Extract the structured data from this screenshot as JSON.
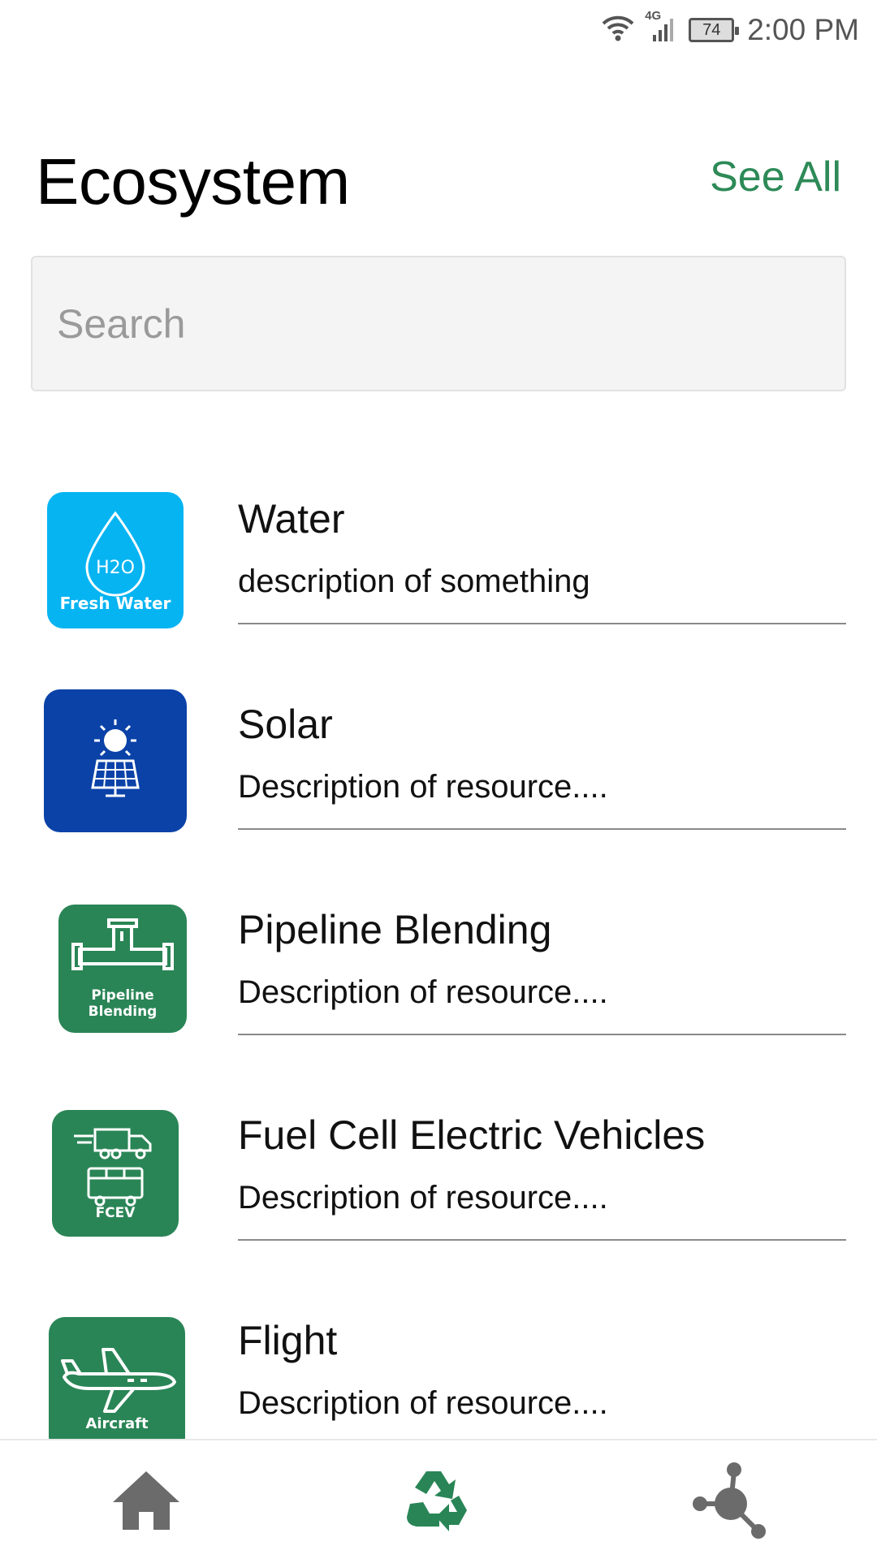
{
  "status_bar": {
    "time": "2:00 PM",
    "battery": "74",
    "network": "4G",
    "icons": [
      "wifi-icon",
      "signal-icon",
      "battery-icon"
    ]
  },
  "header": {
    "title": "Ecosystem",
    "see_all_label": "See All"
  },
  "search": {
    "placeholder": "Search",
    "value": ""
  },
  "items": [
    {
      "title": "Water",
      "description": "description of something",
      "icon": "fresh-water-icon",
      "icon_label": "Fresh Water",
      "icon_glyph": "H2O",
      "icon_color": "#06b4f2"
    },
    {
      "title": "Solar",
      "description": "Description of resource....",
      "icon": "solar-panel-icon",
      "icon_label": "",
      "icon_color": "#0a42a8"
    },
    {
      "title": "Pipeline Blending",
      "description": "Description of resource....",
      "icon": "pipeline-icon",
      "icon_label_line1": "Pipeline",
      "icon_label_line2": "Blending",
      "icon_color": "#2a8556"
    },
    {
      "title": "Fuel Cell Electric Vehicles",
      "description": "Description of resource....",
      "icon": "fcev-icon",
      "icon_label": "FCEV",
      "icon_color": "#2a8556"
    },
    {
      "title": "Flight",
      "description": "Description of resource....",
      "icon": "aircraft-icon",
      "icon_label": "Aircraft",
      "icon_color": "#2a8556"
    }
  ],
  "bottom_nav": {
    "items": [
      {
        "name": "home",
        "icon": "home-icon",
        "color": "#6b6b6b"
      },
      {
        "name": "recycle",
        "icon": "recycle-icon",
        "color": "#2a8556",
        "active": true
      },
      {
        "name": "network",
        "icon": "network-icon",
        "color": "#6b6b6b"
      }
    ]
  }
}
